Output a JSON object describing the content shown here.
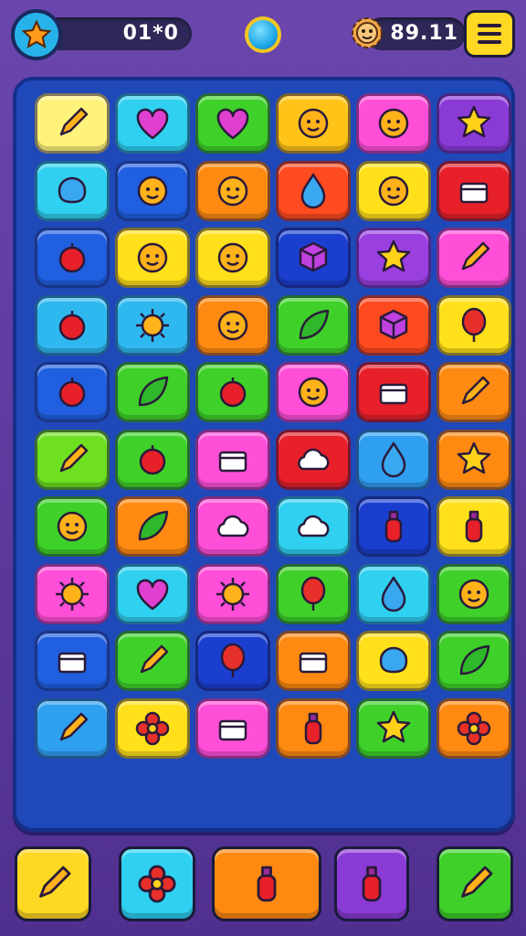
{
  "hud": {
    "score_text": "01*0",
    "coins_text": "89.11",
    "icons": {
      "score": "star-icon",
      "coins": "gear-icon",
      "center": "orb-icon",
      "menu": "hamburger-menu-icon"
    }
  },
  "board": {
    "columns": 6,
    "rows": 10,
    "tiles": [
      {
        "color": "#fff27a",
        "icon": "rocket-chili-icon"
      },
      {
        "color": "#2fd0f0",
        "icon": "heart-balloon-icon"
      },
      {
        "color": "#3fd12a",
        "icon": "heart-battery-icon"
      },
      {
        "color": "#ffc417",
        "icon": "swirl-icon"
      },
      {
        "color": "#ff4fd8",
        "icon": "cupcake-icon"
      },
      {
        "color": "#8a3bd6",
        "icon": "star-tv-icon"
      },
      {
        "color": "#2fd0f0",
        "icon": "blob-icon"
      },
      {
        "color": "#1f5fe0",
        "icon": "bulb-icon"
      },
      {
        "color": "#ff8a12",
        "icon": "figure-icon"
      },
      {
        "color": "#ff4b1f",
        "icon": "drop-icon"
      },
      {
        "color": "#ffe01a",
        "icon": "fish-icon"
      },
      {
        "color": "#e8202a",
        "icon": "toast-icon"
      },
      {
        "color": "#1f5fe0",
        "icon": "bird-icon"
      },
      {
        "color": "#ffe01a",
        "icon": "face-icon"
      },
      {
        "color": "#ffe01a",
        "icon": "bell-icon"
      },
      {
        "color": "#1a3fd0",
        "icon": "cube-icon"
      },
      {
        "color": "#9a3fe0",
        "icon": "star-icon"
      },
      {
        "color": "#ff4fd8",
        "icon": "pencil-icon"
      },
      {
        "color": "#2fb8f0",
        "icon": "snail-icon"
      },
      {
        "color": "#2fb8f0",
        "icon": "sun-icon"
      },
      {
        "color": "#ff8a12",
        "icon": "pumpkin-icon"
      },
      {
        "color": "#3fd12a",
        "icon": "leaf-icon"
      },
      {
        "color": "#ff4b1f",
        "icon": "house-icon"
      },
      {
        "color": "#ffe01a",
        "icon": "balloon-icon"
      },
      {
        "color": "#1f5fe0",
        "icon": "candy-icon"
      },
      {
        "color": "#3fd12a",
        "icon": "flag-icon"
      },
      {
        "color": "#3fd12a",
        "icon": "egg-icon"
      },
      {
        "color": "#ff4fd8",
        "icon": "horn-icon"
      },
      {
        "color": "#e8202a",
        "icon": "camera-icon"
      },
      {
        "color": "#ff8a12",
        "icon": "rocket-icon"
      },
      {
        "color": "#6ee020",
        "icon": "ruler-icon"
      },
      {
        "color": "#3fd12a",
        "icon": "apple-icon"
      },
      {
        "color": "#ff4fd8",
        "icon": "robot-icon"
      },
      {
        "color": "#e8202a",
        "icon": "chef-hat-icon"
      },
      {
        "color": "#2f9ff0",
        "icon": "drop-icon"
      },
      {
        "color": "#ff8a12",
        "icon": "star-icon"
      },
      {
        "color": "#3fd12a",
        "icon": "face-icon"
      },
      {
        "color": "#ff8a12",
        "icon": "leaf-icon"
      },
      {
        "color": "#ff4fd8",
        "icon": "ghost-icon"
      },
      {
        "color": "#2fd0f0",
        "icon": "cloud-icon"
      },
      {
        "color": "#1a3fd0",
        "icon": "bag-icon"
      },
      {
        "color": "#ffe01a",
        "icon": "bottle-icon"
      },
      {
        "color": "#ff4fd8",
        "icon": "sun-icon"
      },
      {
        "color": "#2fd0f0",
        "icon": "heart-icon"
      },
      {
        "color": "#ff4fd8",
        "icon": "splat-icon"
      },
      {
        "color": "#3fd12a",
        "icon": "balloon-icon"
      },
      {
        "color": "#2fd0f0",
        "icon": "drop-icon"
      },
      {
        "color": "#3fd12a",
        "icon": "bug-icon"
      },
      {
        "color": "#1f5fe0",
        "icon": "box-icon"
      },
      {
        "color": "#3fd12a",
        "icon": "pencil-icon"
      },
      {
        "color": "#1a3fd0",
        "icon": "hot-air-balloon-icon"
      },
      {
        "color": "#ff8a12",
        "icon": "briefcase-icon"
      },
      {
        "color": "#ffe01a",
        "icon": "blob-icon"
      },
      {
        "color": "#3fd12a",
        "icon": "boat-icon"
      },
      {
        "color": "#2f9ff0",
        "icon": "plane-icon"
      },
      {
        "color": "#ffe01a",
        "icon": "flower-icon"
      },
      {
        "color": "#ff4fd8",
        "icon": "bread-icon"
      },
      {
        "color": "#ff8a12",
        "icon": "lantern-icon"
      },
      {
        "color": "#3fd12a",
        "icon": "star-icon"
      },
      {
        "color": "#ff8a12",
        "icon": "flower-icon"
      }
    ]
  },
  "toolbar": [
    {
      "color": "#ffd823",
      "icon": "crayon-icon"
    },
    {
      "color": "#2fd0f0",
      "icon": "flower-icon"
    },
    {
      "color": "#ff8a12",
      "icon": "bottle-icon"
    },
    {
      "color": "#8a3bd6",
      "icon": "keyhole-icon"
    },
    {
      "color": "#3fd12a",
      "icon": "magic-wand-icon"
    }
  ]
}
